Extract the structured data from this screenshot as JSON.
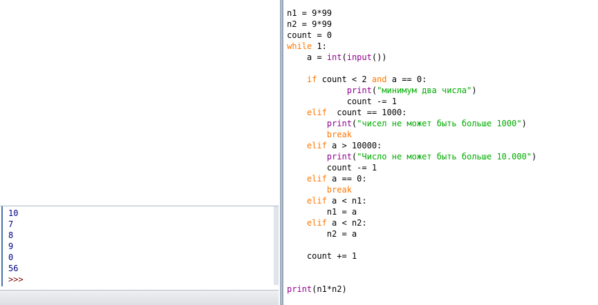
{
  "shell": {
    "lines": [
      {
        "text": "10",
        "kind": "out"
      },
      {
        "text": "7",
        "kind": "out"
      },
      {
        "text": "8",
        "kind": "out"
      },
      {
        "text": "9",
        "kind": "out"
      },
      {
        "text": "0",
        "kind": "out"
      },
      {
        "text": "56",
        "kind": "out"
      },
      {
        "text": ">>>",
        "kind": "prompt"
      }
    ]
  },
  "editor": {
    "lines": [
      [
        {
          "t": "n1 = 9*99",
          "c": ""
        }
      ],
      [
        {
          "t": "n2 = 9*99",
          "c": ""
        }
      ],
      [
        {
          "t": "count = 0",
          "c": ""
        }
      ],
      [
        {
          "t": "while",
          "c": "kw"
        },
        {
          "t": " 1:",
          "c": ""
        }
      ],
      [
        {
          "t": "    a = ",
          "c": ""
        },
        {
          "t": "int",
          "c": "bi"
        },
        {
          "t": "(",
          "c": ""
        },
        {
          "t": "input",
          "c": "bi"
        },
        {
          "t": "())",
          "c": ""
        }
      ],
      [
        {
          "t": "",
          "c": ""
        }
      ],
      [
        {
          "t": "    ",
          "c": ""
        },
        {
          "t": "if",
          "c": "kw"
        },
        {
          "t": " count < 2 ",
          "c": ""
        },
        {
          "t": "and",
          "c": "kw"
        },
        {
          "t": " a == 0:",
          "c": ""
        }
      ],
      [
        {
          "t": "            ",
          "c": ""
        },
        {
          "t": "print",
          "c": "bi"
        },
        {
          "t": "(",
          "c": ""
        },
        {
          "t": "\"минимум два числа\"",
          "c": "st"
        },
        {
          "t": ")",
          "c": ""
        }
      ],
      [
        {
          "t": "            count -= 1",
          "c": ""
        }
      ],
      [
        {
          "t": "    ",
          "c": ""
        },
        {
          "t": "elif",
          "c": "kw"
        },
        {
          "t": "  count == 1000:",
          "c": ""
        }
      ],
      [
        {
          "t": "        ",
          "c": ""
        },
        {
          "t": "print",
          "c": "bi"
        },
        {
          "t": "(",
          "c": ""
        },
        {
          "t": "\"чисел не может быть больше 1000\"",
          "c": "st"
        },
        {
          "t": ")",
          "c": ""
        }
      ],
      [
        {
          "t": "        ",
          "c": ""
        },
        {
          "t": "break",
          "c": "kw"
        }
      ],
      [
        {
          "t": "    ",
          "c": ""
        },
        {
          "t": "elif",
          "c": "kw"
        },
        {
          "t": " a > 10000:",
          "c": ""
        }
      ],
      [
        {
          "t": "        ",
          "c": ""
        },
        {
          "t": "print",
          "c": "bi"
        },
        {
          "t": "(",
          "c": ""
        },
        {
          "t": "\"Число не может быть больше 10.000\"",
          "c": "st"
        },
        {
          "t": ")",
          "c": ""
        }
      ],
      [
        {
          "t": "        count -= 1",
          "c": ""
        }
      ],
      [
        {
          "t": "    ",
          "c": ""
        },
        {
          "t": "elif",
          "c": "kw"
        },
        {
          "t": " a == 0:",
          "c": ""
        }
      ],
      [
        {
          "t": "        ",
          "c": ""
        },
        {
          "t": "break",
          "c": "kw"
        }
      ],
      [
        {
          "t": "    ",
          "c": ""
        },
        {
          "t": "elif",
          "c": "kw"
        },
        {
          "t": " a < n1:",
          "c": ""
        }
      ],
      [
        {
          "t": "        n1 = a",
          "c": ""
        }
      ],
      [
        {
          "t": "    ",
          "c": ""
        },
        {
          "t": "elif",
          "c": "kw"
        },
        {
          "t": " a < n2:",
          "c": ""
        }
      ],
      [
        {
          "t": "        n2 = a",
          "c": ""
        }
      ],
      [
        {
          "t": "",
          "c": ""
        }
      ],
      [
        {
          "t": "    count += 1",
          "c": ""
        }
      ],
      [
        {
          "t": "",
          "c": ""
        }
      ],
      [
        {
          "t": "",
          "c": ""
        }
      ],
      [
        {
          "t": "print",
          "c": "bi"
        },
        {
          "t": "(n1*n2)",
          "c": ""
        }
      ]
    ]
  },
  "colors": {
    "keyword": "#ff7700",
    "builtin": "#900090",
    "string": "#00aa00",
    "shell_output": "#000080",
    "shell_prompt": "#7f0000"
  }
}
